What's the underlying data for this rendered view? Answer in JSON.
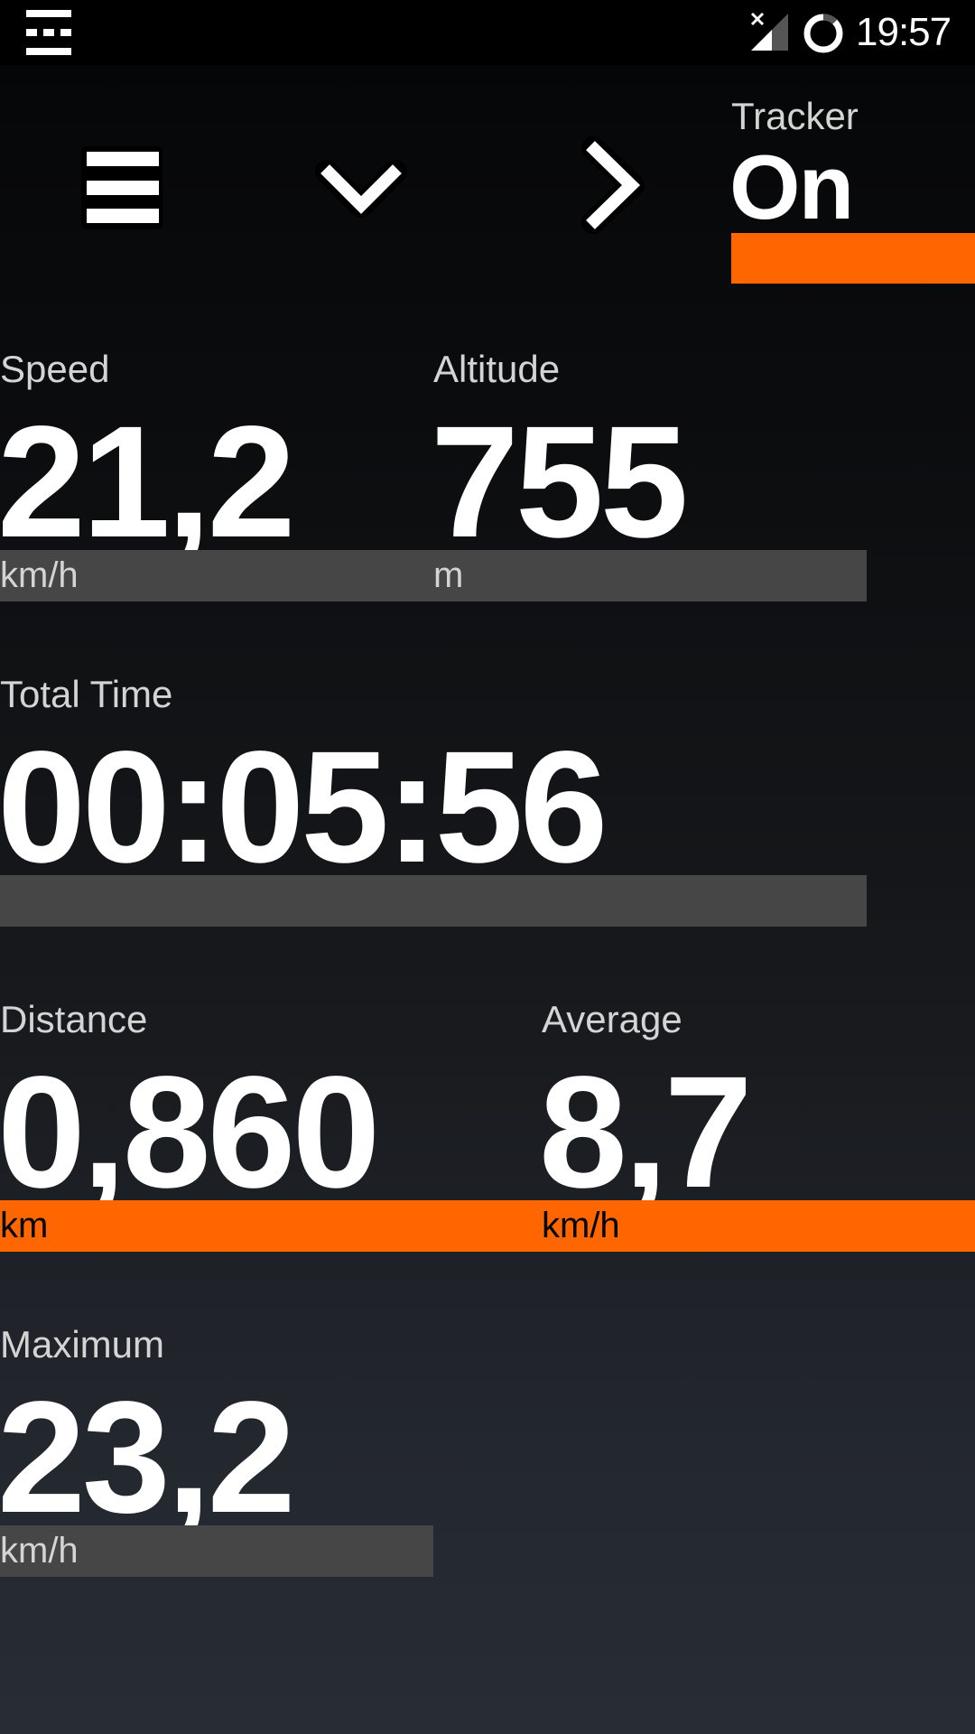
{
  "status_bar": {
    "time": "19:57",
    "icons": [
      "notification-icon",
      "signal-no-sim-icon",
      "battery-ring-icon"
    ]
  },
  "toolbar": {
    "menu_icon": "hamburger-menu-icon",
    "down_icon": "chevron-down-icon",
    "next_icon": "chevron-right-icon",
    "tracker": {
      "label": "Tracker",
      "value": "On",
      "accent_color": "#ff6600"
    }
  },
  "fields": {
    "speed": {
      "label": "Speed",
      "value": "21,2",
      "unit": "km/h"
    },
    "altitude": {
      "label": "Altitude",
      "value": "755",
      "unit": "m"
    },
    "total_time": {
      "label": "Total Time",
      "value": "00:05:56",
      "unit": ""
    },
    "distance": {
      "label": "Distance",
      "value": "0,860",
      "unit": "km"
    },
    "average": {
      "label": "Average",
      "value": "8,7",
      "unit": "km/h"
    },
    "maximum": {
      "label": "Maximum",
      "value": "23,2",
      "unit": "km/h"
    }
  },
  "colors": {
    "accent": "#ff6600",
    "unit_bar_gray": "#464646",
    "label_text": "#d4d4d4"
  }
}
